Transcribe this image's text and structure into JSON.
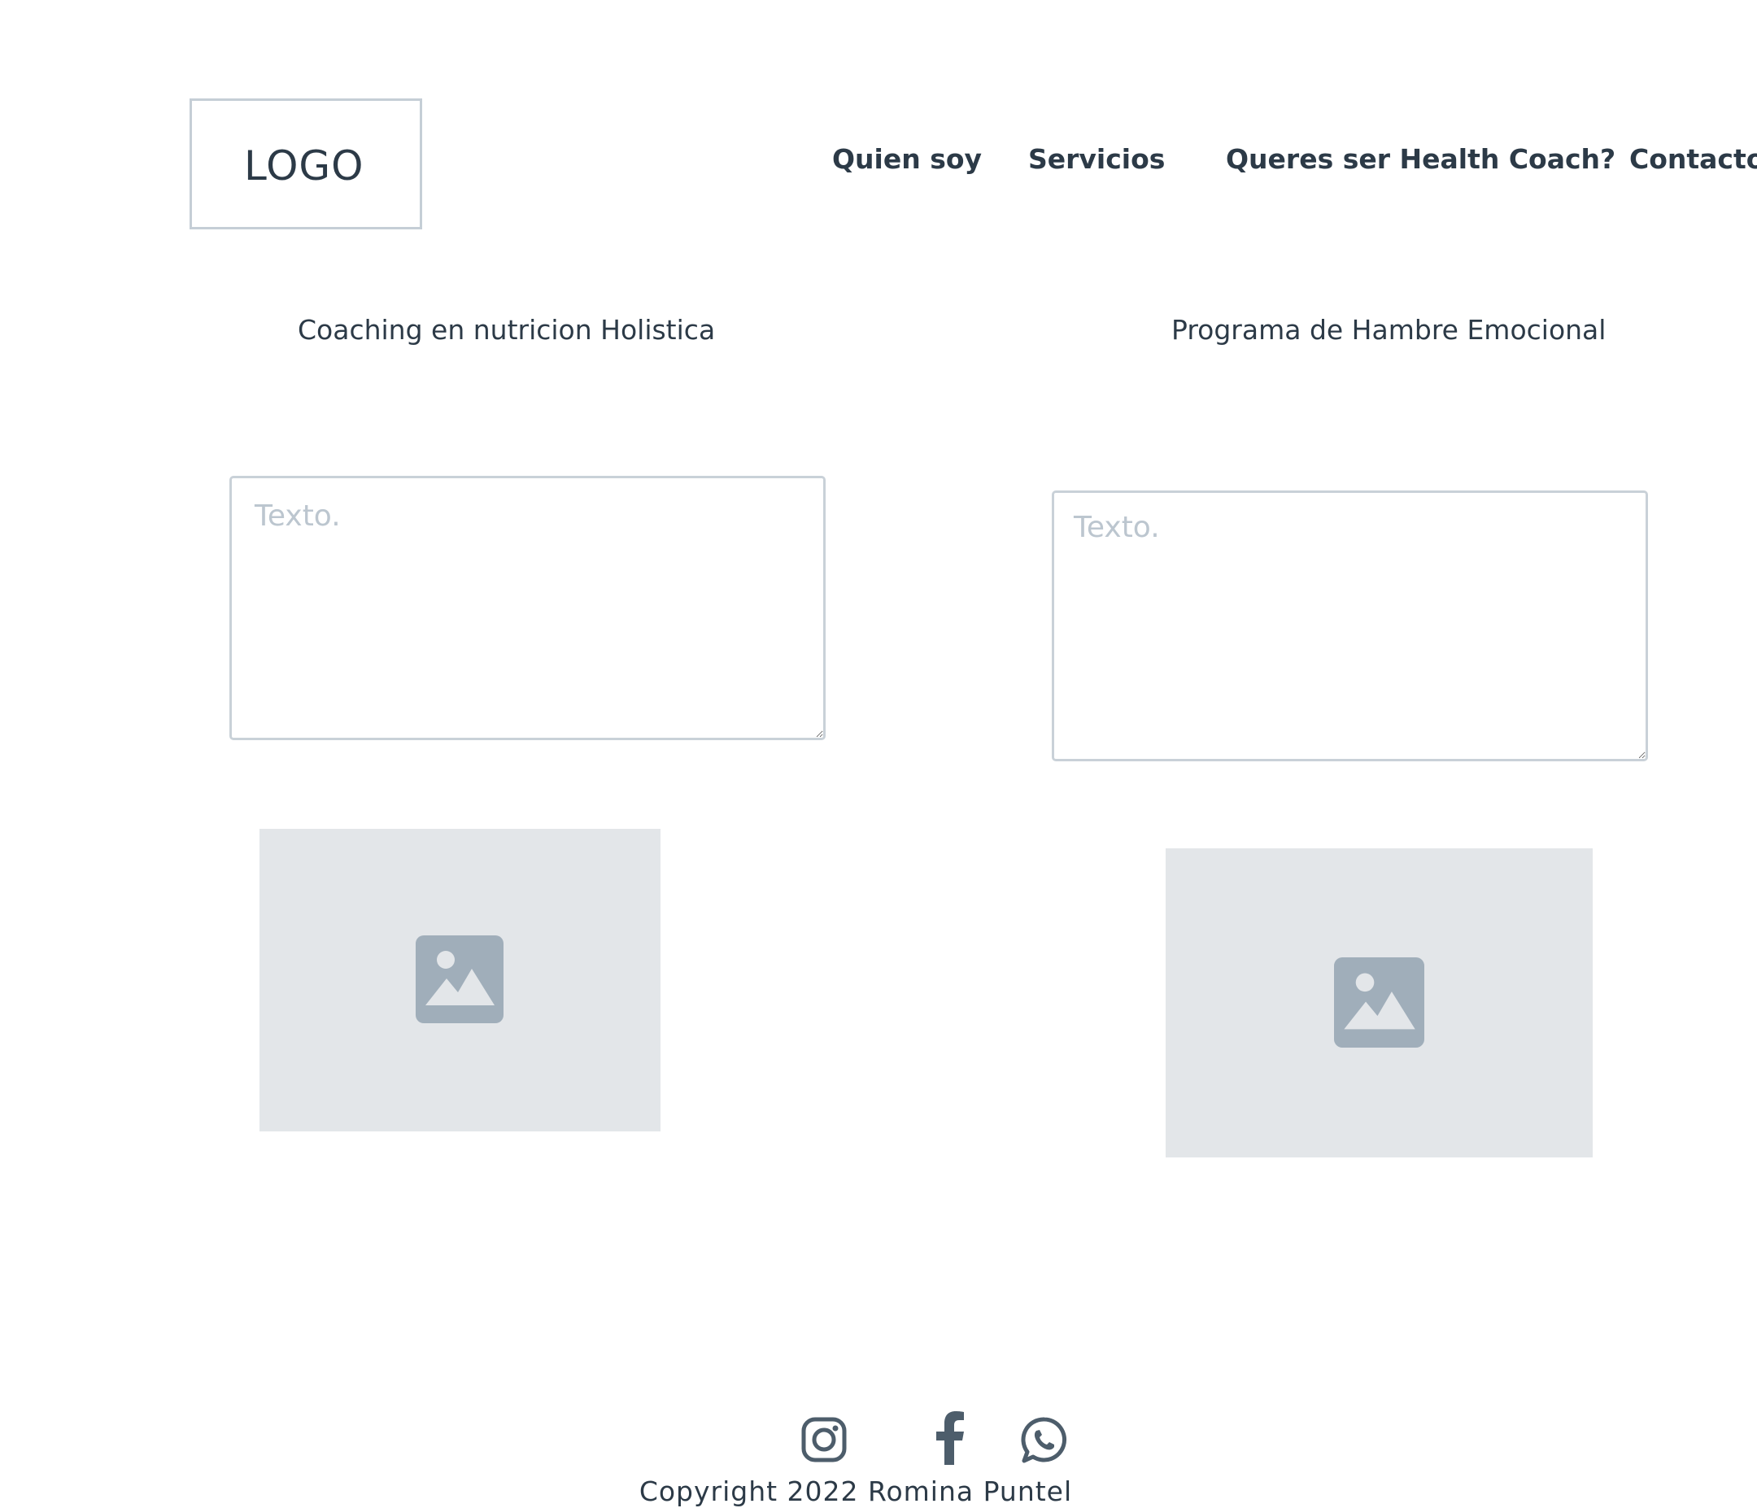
{
  "header": {
    "logo": "LOGO",
    "nav": [
      {
        "label": "Quien soy"
      },
      {
        "label": "Servicios"
      },
      {
        "label": "Queres ser Health Coach?"
      },
      {
        "label": "Contacto"
      }
    ]
  },
  "services": [
    {
      "title": "Coaching en nutricion Holistica",
      "placeholder": "Texto.",
      "image_icon": "image-icon"
    },
    {
      "title": "Programa de Hambre Emocional",
      "placeholder": "Texto.",
      "image_icon": "image-icon"
    }
  ],
  "footer": {
    "social": [
      {
        "icon": "instagram-icon"
      },
      {
        "icon": "facebook-icon"
      },
      {
        "icon": "whatsapp-icon"
      }
    ],
    "copyright": "Copyright 2022 Romina Puntel"
  },
  "colors": {
    "text": "#2c3a47",
    "border": "#c9d1d8",
    "placeholder_bg": "#e3e6e9",
    "placeholder_icon": "#a0aeba",
    "social_icon": "#4d5d6b"
  }
}
